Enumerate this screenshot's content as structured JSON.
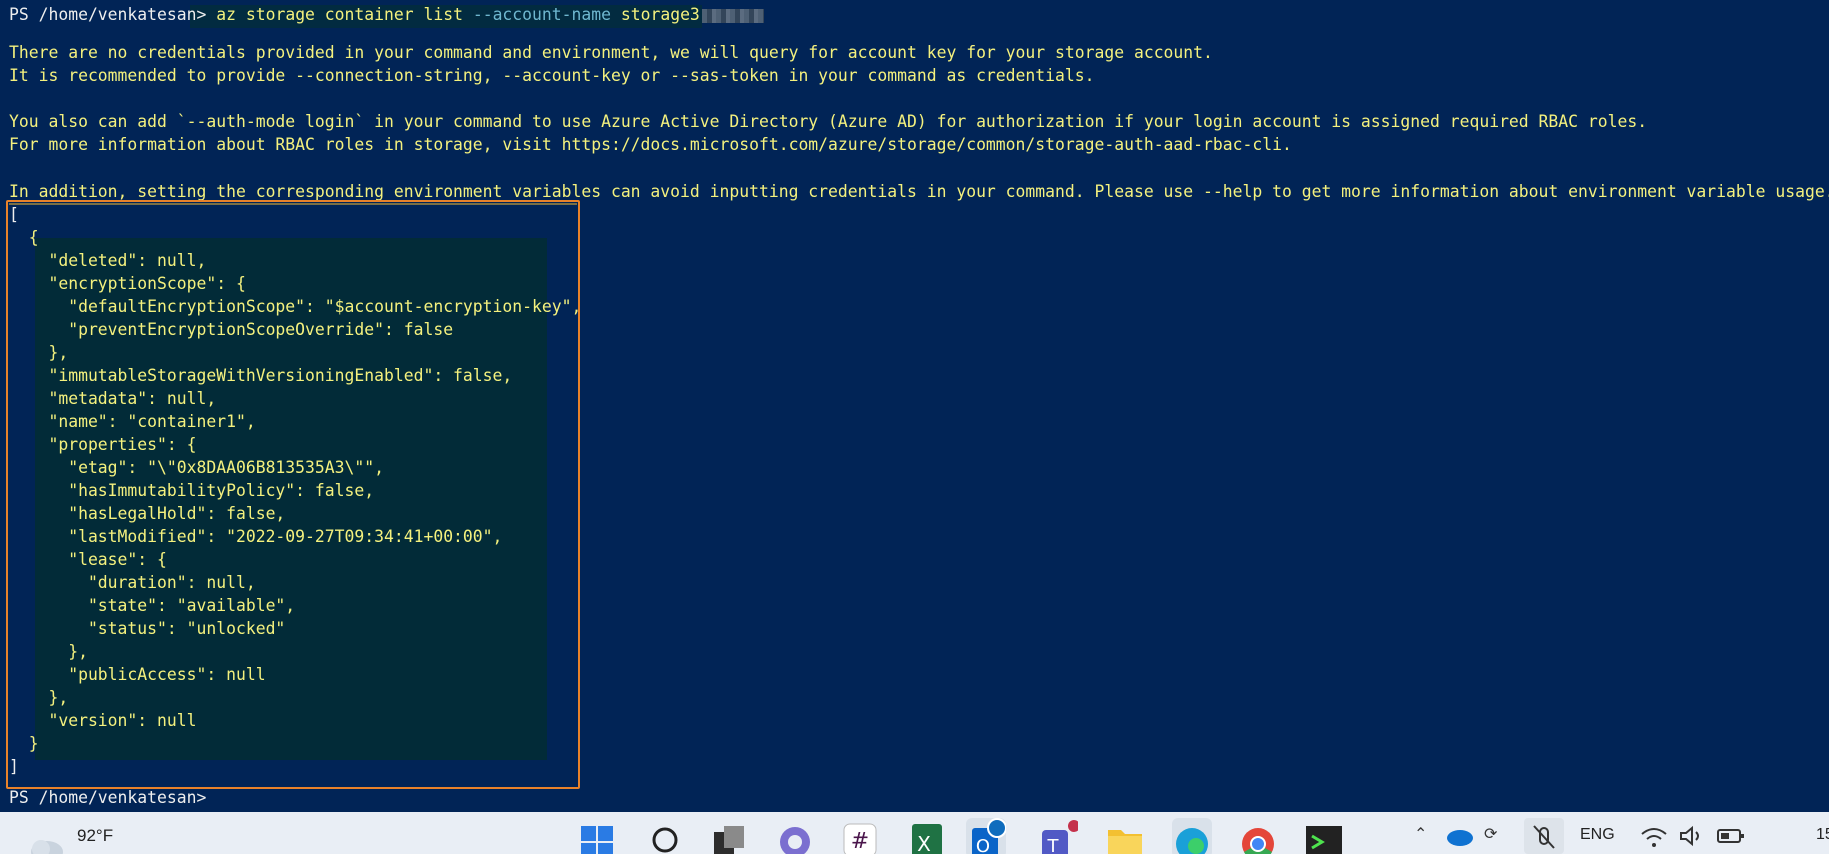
{
  "terminal": {
    "prompt": "PS /home/venkatesan>",
    "command": "az storage container list",
    "command_option": "--account-name",
    "command_arg": "storage3",
    "warnings": [
      "There are no credentials provided in your command and environment, we will query for account key for your storage account.",
      "It is recommended to provide --connection-string, --account-key or --sas-token in your command as credentials.",
      "You also can add `--auth-mode login` in your command to use Azure Active Directory (Azure AD) for authorization if your login account is assigned required RBAC roles.",
      "For more information about RBAC roles in storage, visit https://docs.microsoft.com/azure/storage/common/storage-auth-aad-rbac-cli.",
      "In addition, setting the corresponding environment variables can avoid inputting credentials in your command. Please use --help to get more information about environment variable usage."
    ],
    "json_lines": [
      "[",
      "  {",
      "    \"deleted\": null,",
      "    \"encryptionScope\": {",
      "      \"defaultEncryptionScope\": \"$account-encryption-key\",",
      "      \"preventEncryptionScopeOverride\": false",
      "    },",
      "    \"immutableStorageWithVersioningEnabled\": false,",
      "    \"metadata\": null,",
      "    \"name\": \"container1\",",
      "    \"properties\": {",
      "      \"etag\": \"\\\"0x8DAA06B813535A3\\\"\",",
      "      \"hasImmutabilityPolicy\": false,",
      "      \"hasLegalHold\": false,",
      "      \"lastModified\": \"2022-09-27T09:34:41+00:00\",",
      "      \"lease\": {",
      "        \"duration\": null,",
      "        \"state\": \"available\",",
      "        \"status\": \"unlocked\"",
      "      },",
      "      \"publicAccess\": null",
      "    },",
      "    \"version\": null",
      "  }",
      "]"
    ],
    "final_prompt": "PS /home/venkatesan>"
  },
  "taskbar": {
    "temperature": "92°F",
    "language": "ENG",
    "clock": "15",
    "icons": [
      "weather-icon",
      "start-icon",
      "search-icon",
      "task-view-icon",
      "chat-icon",
      "slack-icon",
      "excel-icon",
      "outlook-icon",
      "teams-icon",
      "file-explorer-icon",
      "edge-icon",
      "chrome-icon",
      "terminal-icon"
    ],
    "tray_icons": [
      "chevron-up-icon",
      "onedrive-icon",
      "sync-icon",
      "mic-muted-icon",
      "wifi-icon",
      "volume-icon",
      "battery-icon"
    ]
  },
  "colors": {
    "terminal_bg": "#012456",
    "output_text": "#f4f17e",
    "prompt_text": "#eeeeee",
    "highlight_box": "#e8822a"
  }
}
